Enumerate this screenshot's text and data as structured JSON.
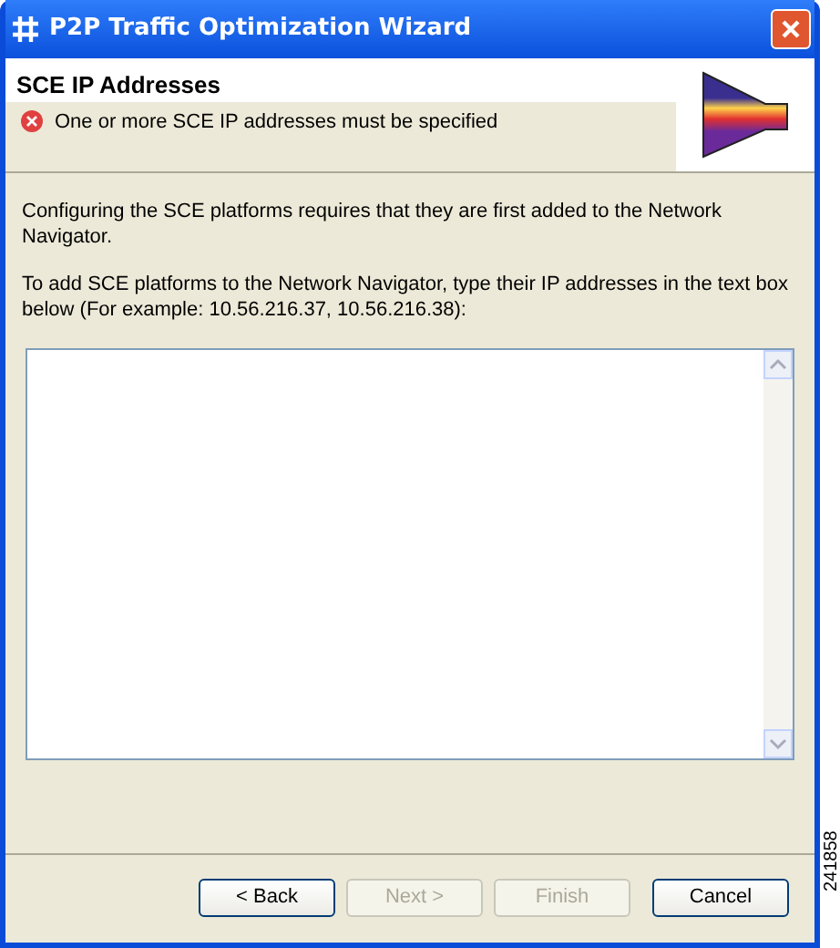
{
  "window": {
    "title": "P2P Traffic Optimization Wizard"
  },
  "header": {
    "title": "SCE IP Addresses",
    "error": "One or more SCE IP addresses must be specified"
  },
  "paragraphs": [
    "Configuring the SCE platforms requires that they are first added to the Network Navigator.",
    "To add SCE platforms to the Network Navigator, type their IP addresses in the text box below (For example: 10.56.216.37, 10.56.216.38):"
  ],
  "buttons": [
    {
      "label": "< Back",
      "disabled": false
    },
    {
      "label": "Next >",
      "disabled": true
    },
    {
      "label": "Finish",
      "disabled": true
    },
    {
      "label": "Cancel",
      "disabled": false
    }
  ],
  "figure_number": "241858"
}
